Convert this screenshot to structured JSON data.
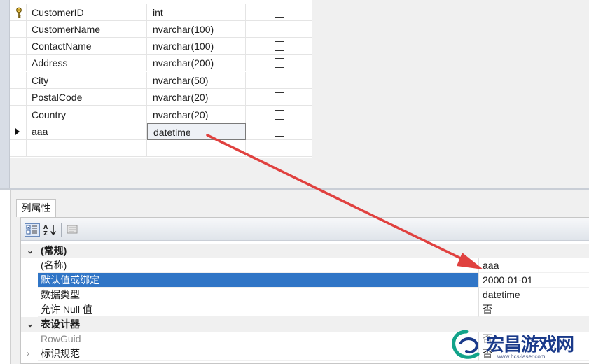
{
  "columns": [
    {
      "name": "CustomerID",
      "type": "int",
      "primary_key": true,
      "allow_null": false
    },
    {
      "name": "CustomerName",
      "type": "nvarchar(100)",
      "allow_null": false
    },
    {
      "name": "ContactName",
      "type": "nvarchar(100)",
      "allow_null": false
    },
    {
      "name": "Address",
      "type": "nvarchar(200)",
      "allow_null": false
    },
    {
      "name": "City",
      "type": "nvarchar(50)",
      "allow_null": false
    },
    {
      "name": "PostalCode",
      "type": "nvarchar(20)",
      "allow_null": false
    },
    {
      "name": "Country",
      "type": "nvarchar(20)",
      "allow_null": false
    },
    {
      "name": "aaa",
      "type": "datetime",
      "allow_null": false,
      "current_row": true
    },
    {
      "name": "",
      "type": "",
      "allow_null": false
    }
  ],
  "properties_tab": {
    "label": "列属性"
  },
  "toolbar": {
    "sort_alpha_glyph": "A↓Z"
  },
  "properties": {
    "general": {
      "label": "(常规)",
      "name_label": "(名称)",
      "name_value": "aaa",
      "default_label": "默认值或绑定",
      "default_value": "2000-01-01",
      "datatype_label": "数据类型",
      "datatype_value": "datetime",
      "allownull_label": "允许 Null 值",
      "allownull_value": "否"
    },
    "table_designer": {
      "label": "表设计器",
      "rowguid_label": "RowGuid",
      "rowguid_value": "否",
      "identity_label": "标识规范",
      "identity_value": "否"
    }
  },
  "watermark": {
    "text": "宏昌游戏网",
    "url": "www.hcs-laser.com"
  },
  "colors": {
    "selection": "#3075c6",
    "arrow": "#e0413f",
    "watermark": "#1a3a8a"
  },
  "icons": [
    "key-icon",
    "row-pointer-icon",
    "categorized-icon",
    "alphabetical-sort-icon",
    "property-pages-icon",
    "expand-icon",
    "collapse-icon"
  ]
}
